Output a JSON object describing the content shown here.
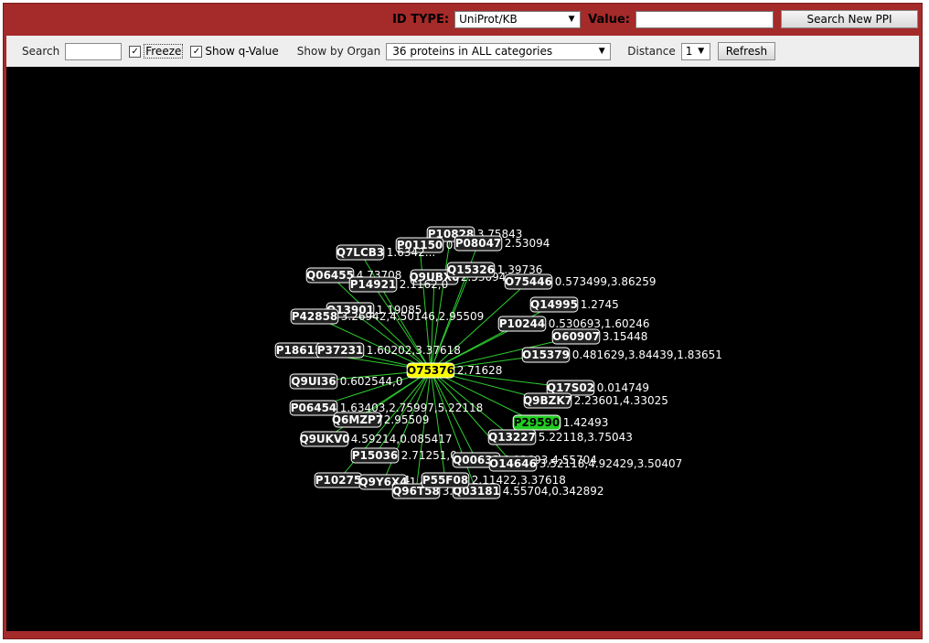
{
  "header": {
    "id_type_label": "ID TYPE:",
    "id_type_value": "UniProt/KB",
    "value_label": "Value:",
    "value_input": "",
    "search_button": "Search New PPI"
  },
  "toolbar": {
    "search_label": "Search",
    "search_value": "",
    "freeze_label": "Freeze",
    "freeze_checked": true,
    "qvalue_label": "Show q-Value",
    "qvalue_checked": true,
    "organ_label": "Show by Organ",
    "organ_value": "36 proteins in ALL categories",
    "distance_label": "Distance",
    "distance_value": "1",
    "refresh_button": "Refresh"
  },
  "colors": {
    "frame": "#a52a2a",
    "canvas": "#000000",
    "edge": "#2ecc2e",
    "center_node": "#ffff00",
    "highlight_node": "#22cc22",
    "node": "#d0d0d0",
    "value_text": "#ffffff"
  },
  "graph": {
    "center": {
      "id": "O75376",
      "qvalue": "2.71628"
    },
    "nodes": [
      {
        "id": "P10828",
        "qvalue": "3.75843"
      },
      {
        "id": "P01150",
        "qvalue": "0.0..."
      },
      {
        "id": "P08047",
        "qvalue": "2.53094"
      },
      {
        "id": "Q7LCB3",
        "qvalue": "1.6342..."
      },
      {
        "id": "Q06455",
        "qvalue": "4.73708"
      },
      {
        "id": "Q9UBX0",
        "qvalue": "2.53094"
      },
      {
        "id": "Q15326",
        "qvalue": "1.39736"
      },
      {
        "id": "O75446",
        "qvalue": "0.573499,3.86259"
      },
      {
        "id": "P14921",
        "qvalue": "2.1162,0"
      },
      {
        "id": "Q14995",
        "qvalue": "1.2745"
      },
      {
        "id": "Q13901",
        "qvalue": "1.19085"
      },
      {
        "id": "P42858",
        "qvalue": "3.26942,4.50146,2.95509"
      },
      {
        "id": "P10244",
        "qvalue": "0.530693,1.60246"
      },
      {
        "id": "O60907",
        "qvalue": "3.15448"
      },
      {
        "id": "P18615",
        "qvalue": ""
      },
      {
        "id": "P37231",
        "qvalue": "1.60202,3.37618"
      },
      {
        "id": "O15379",
        "qvalue": "0.481629,3.84439,1.83651"
      },
      {
        "id": "Q9UI36",
        "qvalue": "0.602544,0"
      },
      {
        "id": "Q17S02",
        "qvalue": "0.014749"
      },
      {
        "id": "Q9BZK7",
        "qvalue": "2.23601,4.33025"
      },
      {
        "id": "P06454",
        "qvalue": "1.63403,2.75997,5.22118"
      },
      {
        "id": "Q6MZP7",
        "qvalue": "2.95509"
      },
      {
        "id": "P29590",
        "qvalue": "1.42493"
      },
      {
        "id": "Q13227",
        "qvalue": "5.22118,3.75043"
      },
      {
        "id": "Q9UKV0",
        "qvalue": "4.59214,0.085417"
      },
      {
        "id": "P15036",
        "qvalue": "2.71251,0"
      },
      {
        "id": "Q00633",
        "qvalue": "4.93693,4.55704"
      },
      {
        "id": "O14646",
        "qvalue": "3.52118,4.92429,3.50407"
      },
      {
        "id": "P10275",
        "qvalue": "2.19954"
      },
      {
        "id": "Q9Y6X4",
        "qvalue": "1.4569"
      },
      {
        "id": "Q96T58",
        "qvalue": "3.2..."
      },
      {
        "id": "Q03181",
        "qvalue": "4.55704,0.342892"
      },
      {
        "id": "P55F08",
        "qvalue": "2.11422,3.37618"
      }
    ]
  }
}
